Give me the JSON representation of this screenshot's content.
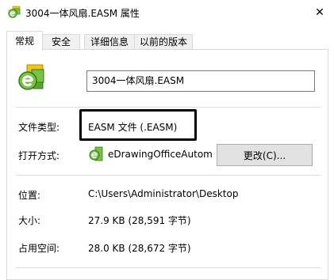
{
  "window": {
    "title": "3004一体风扇.EASM 属性",
    "close_symbol": "✕"
  },
  "tabs": [
    {
      "label": "常规",
      "active": true
    },
    {
      "label": "安全",
      "active": false
    },
    {
      "label": "详细信息",
      "active": false
    },
    {
      "label": "以前的版本",
      "active": false
    }
  ],
  "general": {
    "file_name": "3004一体风扇.EASM",
    "file_type_label": "文件类型:",
    "file_type_value": "EASM 文件 (.EASM)",
    "opens_with_label": "打开方式:",
    "opens_with_value": "eDrawingOfficeAutom.",
    "change_button": "更改(C)...",
    "location_label": "位置:",
    "location_value": "C:\\Users\\Administrator\\Desktop",
    "size_label": "大小:",
    "size_value": "27.9 KB (28,591 字节)",
    "size_on_disk_label": "占用空间:",
    "size_on_disk_value": "28.0 KB (28,672 字节)"
  },
  "icons": {
    "title_icon": "easm-file-icon",
    "big_icon": "easm-file-icon",
    "app_icon": "edrawings-app-icon",
    "close_icon": "close-icon"
  },
  "colors": {
    "icon_green": "#7cc242",
    "icon_yellow": "#f2c318",
    "icon_dark_green": "#2f7a1c"
  }
}
